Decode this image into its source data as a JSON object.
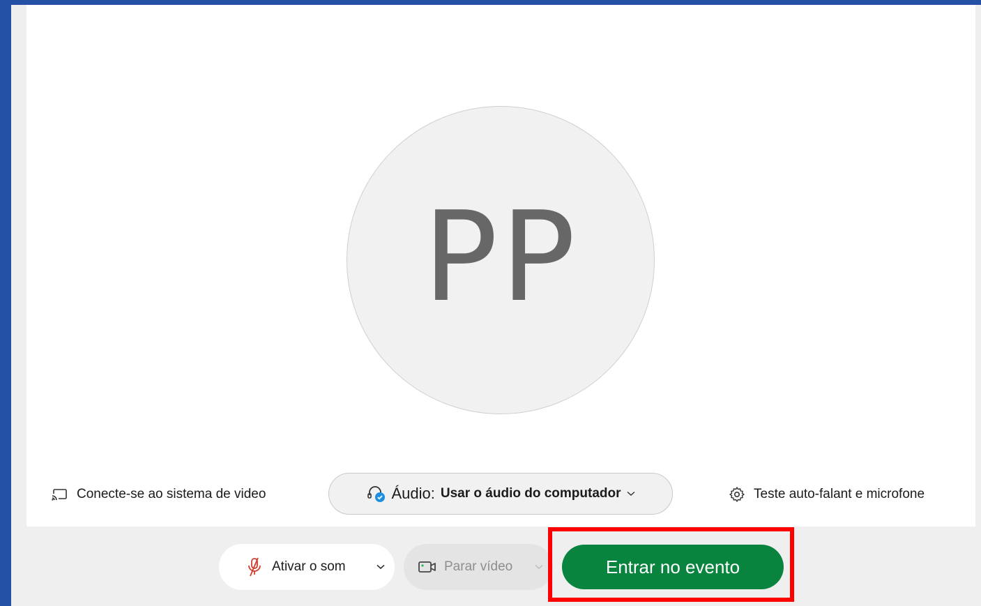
{
  "avatar": {
    "initials": "PP"
  },
  "bottom_options": {
    "video_system_label": "Conecte-se ao sistema de video",
    "audio_label": "Áudio:",
    "audio_value": "Usar o áudio do computador",
    "test_label": "Teste auto-falant e microfone"
  },
  "controls": {
    "mute_label": "Ativar o som",
    "video_label": "Parar vídeo",
    "join_label": "Entrar no evento"
  },
  "colors": {
    "background_blue": "#2450a5",
    "join_green": "#08843e",
    "highlight_red": "#ff0000",
    "muted_mic_red": "#d23c2f",
    "audio_check_blue": "#1d8fe1"
  },
  "icons": {
    "video_system": "cast-icon",
    "audio": "headset-icon",
    "audio_dropdown": "chevron-down-icon",
    "test": "gear-icon",
    "mute": "mic-off-icon",
    "mute_dropdown": "chevron-down-icon",
    "video": "camera-icon",
    "video_dropdown": "chevron-down-icon"
  }
}
